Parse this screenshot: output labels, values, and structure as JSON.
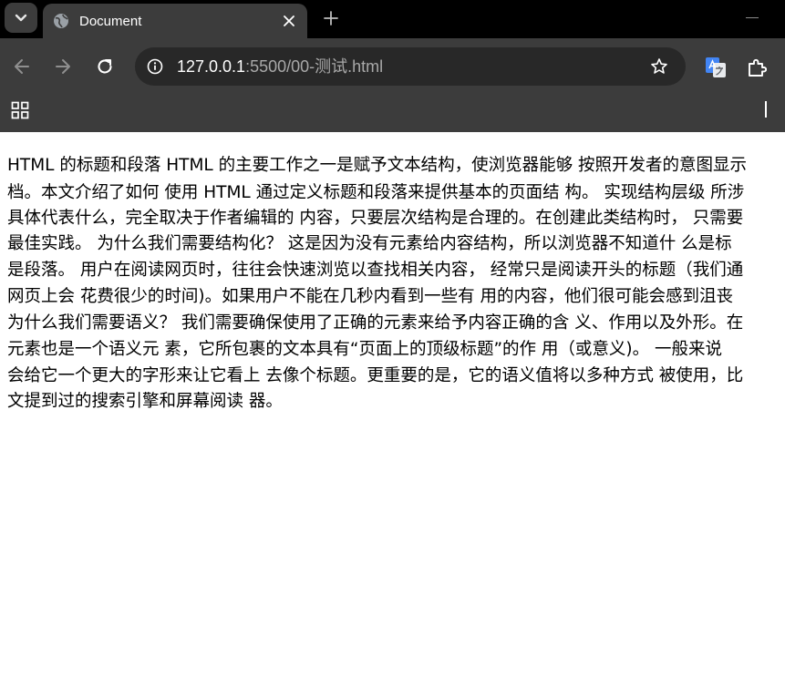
{
  "browser": {
    "tab": {
      "title": "Document",
      "favicon_icon": "globe-icon",
      "close_icon": "close-icon"
    },
    "tab_search_icon": "chevron-down-icon",
    "new_tab_icon": "plus-icon",
    "nav": {
      "back_icon": "arrow-left-icon",
      "forward_icon": "arrow-right-icon",
      "reload_icon": "reload-icon"
    },
    "omnibox": {
      "site_info_icon": "info-icon",
      "url_host": "127.0.0.1",
      "url_rest": ":5500/00-测试.html",
      "bookmark_icon": "star-icon"
    },
    "extensions": {
      "translate_icon": "google-translate-icon",
      "puzzle_icon": "puzzle-icon"
    },
    "bookmarks_bar": {
      "apps_icon": "apps-grid-icon"
    },
    "colors": {
      "tabstrip": "#000000",
      "toolbar": "#3c3c3c",
      "omnibox": "#282828",
      "translate_blue": "#4285f4"
    }
  },
  "document": {
    "lines": [
      "HTML 的标题和段落 HTML 的主要工作之一是赋予文本结构，使浏览器能够 按照开发者的意图显示",
      "档。本文介绍了如何 使用 HTML 通过定义标题和段落来提供基本的页面结 构。 实现结构层级 所涉",
      "具体代表什么，完全取决于作者编辑的 内容，只要层次结构是合理的。在创建此类结构时， 只需要",
      "最佳实践。 为什么我们需要结构化？ 这是因为没有元素给内容结构，所以浏览器不知道什 么是标",
      "是段落。 用户在阅读网页时，往往会快速浏览以查找相关内容， 经常只是阅读开头的标题（我们通",
      "网页上会 花费很少的时间)。如果用户不能在几秒内看到一些有 用的内容，他们很可能会感到沮丧",
      "为什么我们需要语义？ 我们需要确保使用了正确的元素来给予内容正确的含 义、作用以及外形。在",
      "元素也是一个语义元 素，它所包裹的文本具有“页面上的顶级标题”的作 用（或意义)。 一般来说",
      "会给它一个更大的字形来让它看上 去像个标题。更重要的是，它的语义值将以多种方式 被使用，比",
      "文提到过的搜索引擎和屏幕阅读 器。"
    ]
  }
}
